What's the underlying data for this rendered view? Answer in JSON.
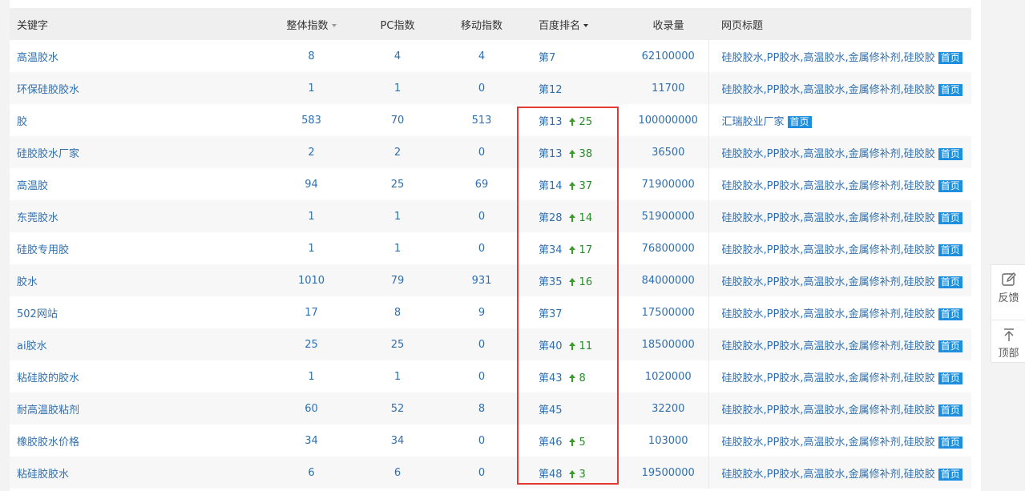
{
  "table": {
    "headers": {
      "keyword": "关键字",
      "overall": "整体指数",
      "pc": "PC指数",
      "mobile": "移动指数",
      "rank": "百度排名",
      "indexed": "收录量",
      "title": "网页标题"
    },
    "home_badge": "首页",
    "rows": [
      {
        "keyword": "高温胶水",
        "overall": "8",
        "pc": "4",
        "mobile": "4",
        "rank": "第7",
        "change": "",
        "indexed": "62100000",
        "title": "硅胶胶水,PP胶水,高温胶水,金属修补剂,硅胶胶"
      },
      {
        "keyword": "环保硅胶胶水",
        "overall": "1",
        "pc": "1",
        "mobile": "0",
        "rank": "第12",
        "change": "",
        "indexed": "11700",
        "title": "硅胶胶水,PP胶水,高温胶水,金属修补剂,硅胶胶"
      },
      {
        "keyword": "胶",
        "overall": "583",
        "pc": "70",
        "mobile": "513",
        "rank": "第13",
        "change": "25",
        "indexed": "100000000",
        "title": "汇瑞胶业厂家"
      },
      {
        "keyword": "硅胶胶水厂家",
        "overall": "2",
        "pc": "2",
        "mobile": "0",
        "rank": "第13",
        "change": "38",
        "indexed": "36500",
        "title": "硅胶胶水,PP胶水,高温胶水,金属修补剂,硅胶胶"
      },
      {
        "keyword": "高温胶",
        "overall": "94",
        "pc": "25",
        "mobile": "69",
        "rank": "第14",
        "change": "37",
        "indexed": "71900000",
        "title": "硅胶胶水,PP胶水,高温胶水,金属修补剂,硅胶胶"
      },
      {
        "keyword": "东莞胶水",
        "overall": "1",
        "pc": "1",
        "mobile": "0",
        "rank": "第28",
        "change": "14",
        "indexed": "51900000",
        "title": "硅胶胶水,PP胶水,高温胶水,金属修补剂,硅胶胶"
      },
      {
        "keyword": "硅胶专用胶",
        "overall": "1",
        "pc": "1",
        "mobile": "0",
        "rank": "第34",
        "change": "17",
        "indexed": "76800000",
        "title": "硅胶胶水,PP胶水,高温胶水,金属修补剂,硅胶胶"
      },
      {
        "keyword": "胶水",
        "overall": "1010",
        "pc": "79",
        "mobile": "931",
        "rank": "第35",
        "change": "16",
        "indexed": "84000000",
        "title": "硅胶胶水,PP胶水,高温胶水,金属修补剂,硅胶胶"
      },
      {
        "keyword": "502网站",
        "overall": "17",
        "pc": "8",
        "mobile": "9",
        "rank": "第37",
        "change": "",
        "indexed": "17500000",
        "title": "硅胶胶水,PP胶水,高温胶水,金属修补剂,硅胶胶"
      },
      {
        "keyword": "ai胶水",
        "overall": "25",
        "pc": "25",
        "mobile": "0",
        "rank": "第40",
        "change": "11",
        "indexed": "18500000",
        "title": "硅胶胶水,PP胶水,高温胶水,金属修补剂,硅胶胶"
      },
      {
        "keyword": "粘硅胶的胶水",
        "overall": "1",
        "pc": "1",
        "mobile": "0",
        "rank": "第43",
        "change": "8",
        "indexed": "1020000",
        "title": "硅胶胶水,PP胶水,高温胶水,金属修补剂,硅胶胶"
      },
      {
        "keyword": "耐高温胶粘剂",
        "overall": "60",
        "pc": "52",
        "mobile": "8",
        "rank": "第45",
        "change": "",
        "indexed": "32200",
        "title": "硅胶胶水,PP胶水,高温胶水,金属修补剂,硅胶胶"
      },
      {
        "keyword": "橡胶胶水价格",
        "overall": "34",
        "pc": "34",
        "mobile": "0",
        "rank": "第46",
        "change": "5",
        "indexed": "103000",
        "title": "硅胶胶水,PP胶水,高温胶水,金属修补剂,硅胶胶"
      },
      {
        "keyword": "粘硅胶胶水",
        "overall": "6",
        "pc": "6",
        "mobile": "0",
        "rank": "第48",
        "change": "3",
        "indexed": "19500000",
        "title": "硅胶胶水,PP胶水,高温胶水,金属修补剂,硅胶胶"
      }
    ]
  },
  "side": {
    "feedback_label": "反馈",
    "top_label": "顶部"
  },
  "colors": {
    "link": "#2f6fb0",
    "up": "#2a8a2a",
    "badge": "#1e8fe0",
    "highlight": "#e53935"
  }
}
